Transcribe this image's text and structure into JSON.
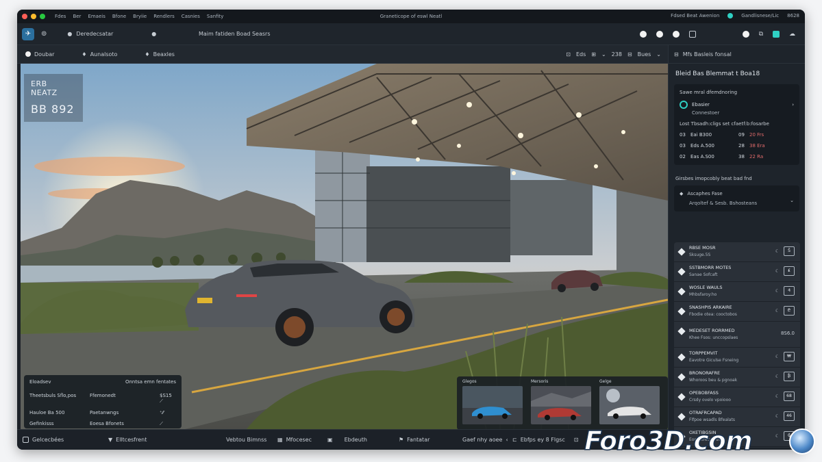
{
  "window": {
    "menu": [
      "Fdes",
      "Ber",
      "Emaeis",
      "Bfone",
      "Bryiie",
      "Rendlers",
      "Casnies",
      "Sanfity"
    ],
    "title": "Graneticope of eswl Neatl",
    "right": [
      "Fdsed Beat Awenion",
      "Gandlisnese/Lic",
      "8628"
    ]
  },
  "toolbar": {
    "document": "Deredecsatar",
    "center": "Maim fatiden Boad Seasrs"
  },
  "subbar": {
    "items": [
      "Doubar",
      "Aunalsoto",
      "Beaxles"
    ],
    "right_a": "Eds",
    "right_b": "238",
    "right_c": "Bues"
  },
  "hud": {
    "line1": "ERB NEATZ",
    "line2": "BB 892"
  },
  "info_panel": {
    "head_left": "Eloadsev",
    "head_right": "Onntsa emn fentates",
    "rows": [
      [
        "Theetsbuls Sflo,pos",
        "Ffemonedt",
        "$S15 ⟋"
      ],
      [
        "Hauloe Ba 500",
        "Paetanwngs",
        "⁺⁄⁄"
      ],
      [
        "Gefinkisss",
        "Eoesa Bfonets",
        "⟋"
      ]
    ]
  },
  "thumbnails": [
    {
      "label": "Glegos"
    },
    {
      "label": "Mersoris"
    },
    {
      "label": "Gelge"
    }
  ],
  "bottombar": {
    "items": [
      "Gelcecbées",
      "Elltcesfrent",
      "Vebtou Bimnss",
      "Mfocesec",
      "Ebdeuth",
      "Fantatar",
      "Gaef nhy aoee",
      "Ebfps ey 8 Flgsc"
    ]
  },
  "rpanel": {
    "header": "Mfs Basleis fonsal",
    "title": "Bleid Bas Blemmat t Boa18",
    "card_title": "Sawe mral dfemdnoring",
    "card_row1": "Ebasier",
    "card_row2": "Connestoer",
    "card_sub": "Lost Tbsadh:cligs set cfaetf:b:fosarbe",
    "stats": [
      [
        "03",
        "Eai B300",
        "09",
        "20 Frs"
      ],
      [
        "03",
        "Eds A.500",
        "28",
        "38 Era"
      ],
      [
        "02",
        "Eas A.S00",
        "38",
        "22 Ra"
      ]
    ],
    "section": "Girsbes imopcobly beat bad fnd",
    "card2_l1": "Ascaphes Fase",
    "card2_l2": "Arqoltef & Sesb. Bshosteans",
    "list": [
      {
        "a": "RBSE MOSR",
        "b": "Sksuge.5S",
        "btn": "Ŝ"
      },
      {
        "a": "SSTBMORR MOTES",
        "b": "Sanae Sofcaft",
        "btn": "₤"
      },
      {
        "a": "WOSLE WAULS",
        "b": "Mhbsfaroy:ho",
        "btn": "₰"
      },
      {
        "a": "SNASHPIS ARKAIRE",
        "b": "Fbodie otea: cooctobos",
        "btn": "₾"
      },
      {
        "a": "MEDESET RORRMED",
        "b": "Khee Fsos: unccopslaes",
        "val": "8S6.0"
      },
      {
        "a": "TORPPEMVIT",
        "b": "Eavotre Giculse Fsneing",
        "btn": "₩"
      },
      {
        "a": "BRONORAFRE",
        "b": "Whoroos beu & pgnoak",
        "btn": "₿"
      },
      {
        "a": "OPEBOBFASS",
        "b": "Crsdy ovelo vpoiooo",
        "btn": "68"
      },
      {
        "a": "OTRAFRCAPAD",
        "b": "Flfpoe wsadls Bfealats",
        "btn": "46"
      },
      {
        "a": "OXETIBGSIN",
        "b": "Eonectrecsarsis",
        "btn": "₲"
      }
    ]
  },
  "watermark": "Foro3D.com"
}
